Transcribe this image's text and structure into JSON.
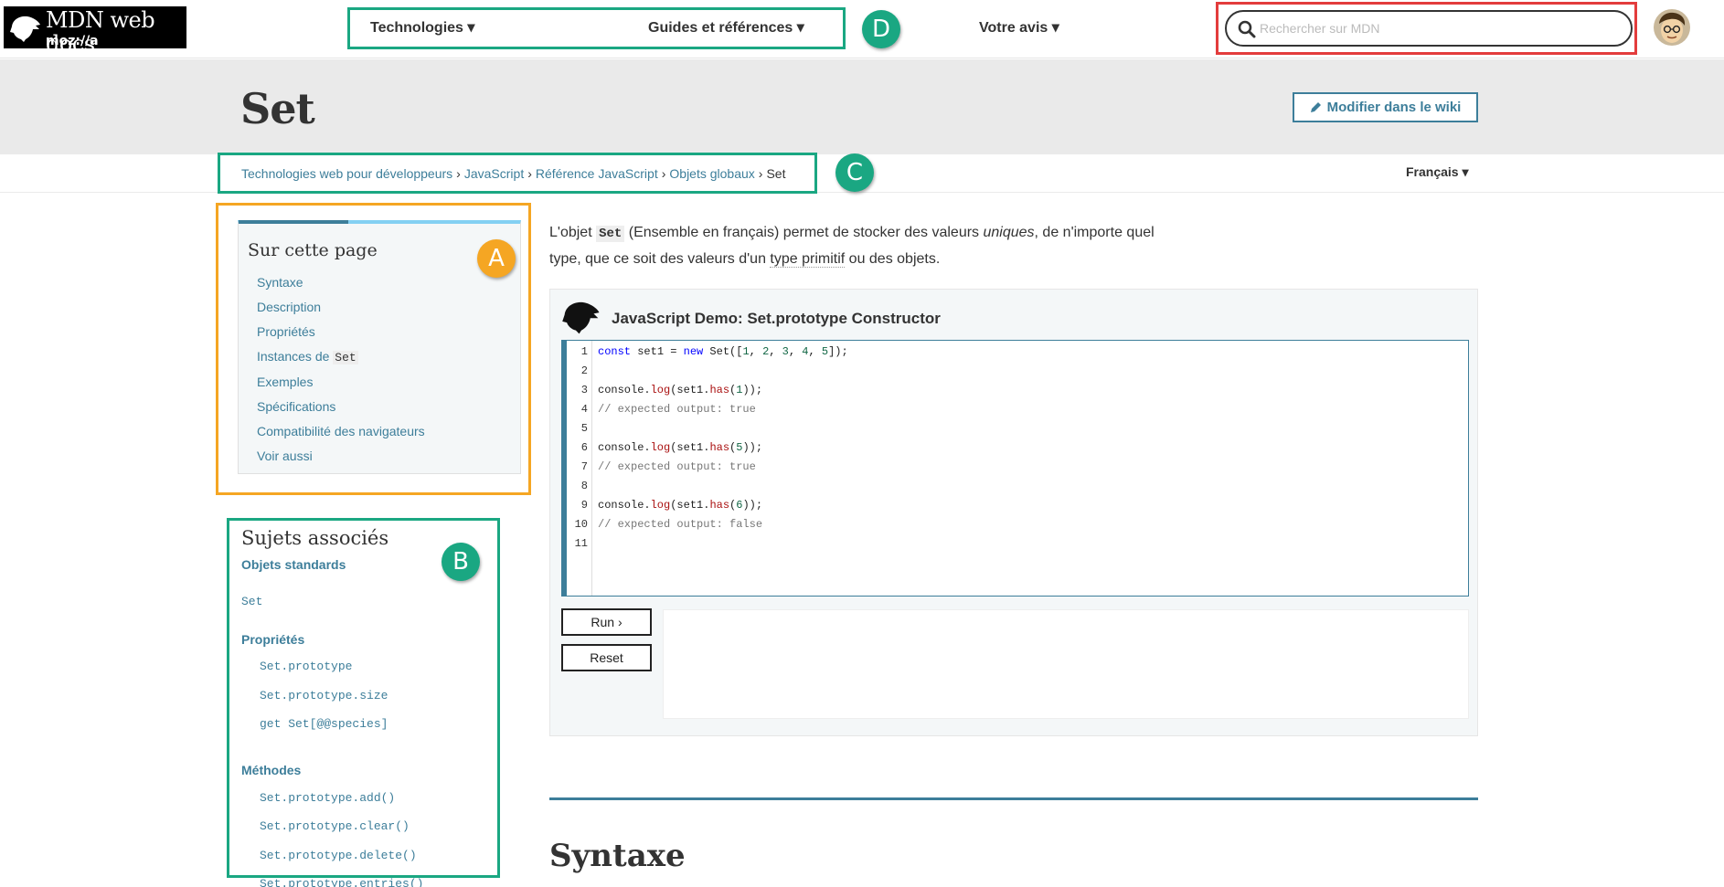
{
  "header": {
    "logo_text": "MDN web docs",
    "logo_sub": "moz://a",
    "nav": [
      {
        "label": "Technologies ▾"
      },
      {
        "label": "Guides et références ▾"
      },
      {
        "label": "Votre avis ▾"
      }
    ],
    "search_placeholder": "Rechercher sur MDN"
  },
  "title": {
    "page_title": "Set",
    "edit_label": "Modifier dans le wiki"
  },
  "breadcrumb": {
    "items": [
      "Technologies web pour développeurs",
      "JavaScript",
      "Référence JavaScript",
      "Objets globaux"
    ],
    "current": "Set",
    "separator": "›",
    "language": "Français ▾"
  },
  "toc": {
    "heading": "Sur cette page",
    "items": [
      "Syntaxe",
      "Description",
      "Propriétés",
      "Instances de",
      "Exemples",
      "Spécifications",
      "Compatibilité des navigateurs",
      "Voir aussi"
    ],
    "instances_code": "Set"
  },
  "related": {
    "heading": "Sujets associés",
    "group_standard": "Objets standards",
    "set_link": "Set",
    "group_props": "Propriétés",
    "props": [
      "Set.prototype",
      "Set.prototype.size",
      "get Set[@@species]"
    ],
    "group_methods": "Méthodes",
    "methods": [
      "Set.prototype.add()",
      "Set.prototype.clear()",
      "Set.prototype.delete()",
      "Set.prototype.entries()"
    ]
  },
  "intro": {
    "p1": "L'objet ",
    "code": "Set",
    "p2": " (Ensemble en français) permet de stocker des valeurs ",
    "em": "uniques",
    "p3": ", de n'importe quel type, que ce soit des valeurs d'un ",
    "abbr": "type primitif",
    "p4": " ou des objets."
  },
  "demo": {
    "title": "JavaScript Demo: Set.prototype Constructor",
    "line_numbers": [
      "1",
      "2",
      "3",
      "4",
      "5",
      "6",
      "7",
      "8",
      "9",
      "10",
      "11"
    ],
    "run_label": "Run ›",
    "reset_label": "Reset"
  },
  "section": {
    "syntax_heading": "Syntaxe"
  },
  "annotations": {
    "a": "A",
    "b": "B",
    "c": "C",
    "d": "D"
  },
  "colors": {
    "link": "#3d7e9a",
    "annotation_orange": "#f5a623",
    "annotation_green": "#1aa782",
    "annotation_red": "#e33c3c",
    "title_band": "#eaeaea"
  }
}
